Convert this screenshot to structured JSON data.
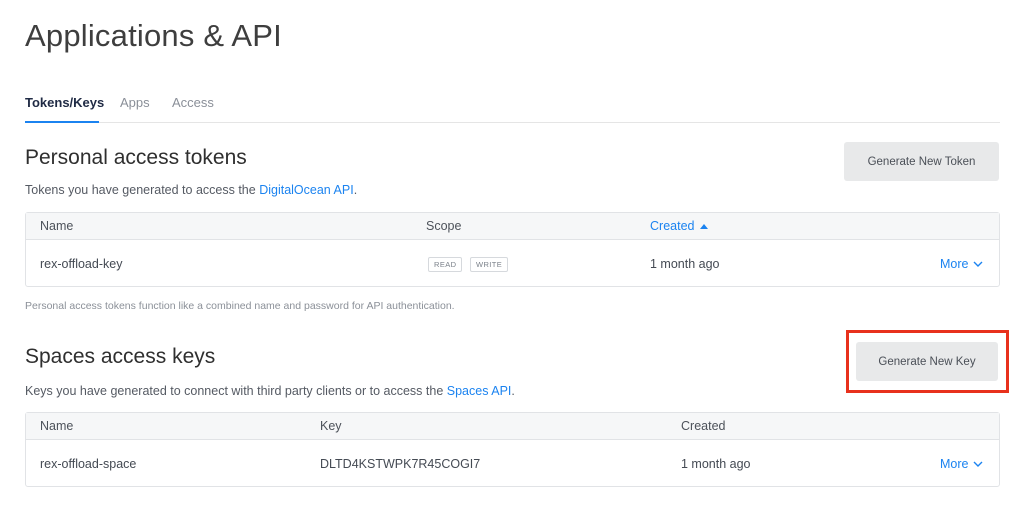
{
  "page": {
    "title": "Applications & API"
  },
  "tabs": [
    {
      "label": "Tokens/Keys",
      "active": true
    },
    {
      "label": "Apps",
      "active": false
    },
    {
      "label": "Access",
      "active": false
    }
  ],
  "tokens": {
    "title": "Personal access tokens",
    "desc_prefix": "Tokens you have generated to access the ",
    "desc_link": "DigitalOcean API",
    "desc_suffix": ".",
    "button_label": "Generate New Token",
    "headers": {
      "name": "Name",
      "scope": "Scope",
      "created": "Created"
    },
    "sort_icon": "caret-up-icon",
    "rows": [
      {
        "name": "rex-offload-key",
        "scopes": [
          "READ",
          "WRITE"
        ],
        "created": "1 month ago",
        "more": "More"
      }
    ],
    "footnote": "Personal access tokens function like a combined name and password for API authentication."
  },
  "spaces": {
    "title": "Spaces access keys",
    "desc_prefix": "Keys you have generated to connect with third party clients or to access the ",
    "desc_link": "Spaces API",
    "desc_suffix": ".",
    "button_label": "Generate New Key",
    "headers": {
      "name": "Name",
      "key": "Key",
      "created": "Created"
    },
    "rows": [
      {
        "name": "rex-offload-space",
        "key": "DLTD4KSTWPK7R45COGI7",
        "created": "1 month ago",
        "more": "More"
      }
    ]
  },
  "colors": {
    "accent": "#1b83f0",
    "highlight": "#e8311c",
    "button_bg": "#e8e9ea"
  }
}
